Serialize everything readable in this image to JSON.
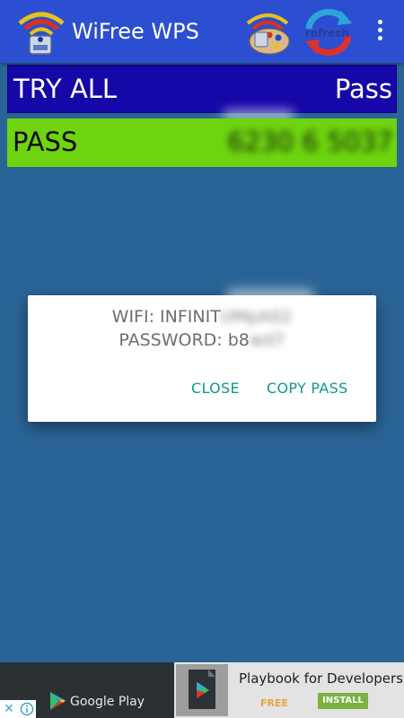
{
  "appbar": {
    "title": "WiFree WPS",
    "refresh_label": "refresh",
    "icons": {
      "logo": "wifi-router-logo-icon",
      "palette": "palette-icon",
      "refresh": "refresh-icon",
      "overflow": "more-vert-icon"
    }
  },
  "rows": {
    "try_all": {
      "left": "TRY ALL",
      "right": "Pass"
    },
    "pass": {
      "left": "PASS",
      "value_visible": "6",
      "value_obscured": "6230 6 5037"
    }
  },
  "dialog": {
    "wifi_prefix": "WIFI: INFINIT",
    "wifi_obscured": "UMpA02",
    "password_prefix": "PASSWORD: b8",
    "password_obscured": "wd7",
    "close_label": "CLOSE",
    "copy_label": "COPY PASS"
  },
  "ad": {
    "store_label": "Google Play",
    "app_title": "Playbook for Developers",
    "price_label": "FREE",
    "install_label": "INSTALL"
  },
  "colors": {
    "appbar": "#2b4fd0",
    "background": "#2a6496",
    "try_all_row": "#1607a8",
    "pass_row": "#6ed40f",
    "dialog_button": "#11968c"
  }
}
